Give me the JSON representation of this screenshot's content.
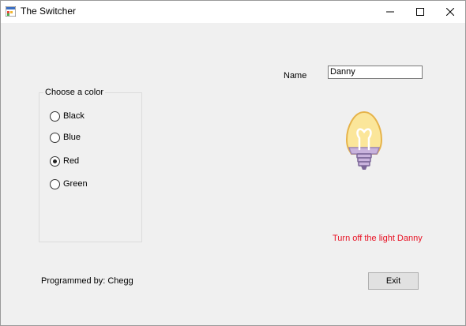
{
  "window": {
    "title": "The Switcher",
    "app_icon": "windows-form-icon",
    "controls": {
      "minimize_icon": "minimize-icon",
      "maximize_icon": "maximize-icon",
      "close_icon": "close-icon"
    }
  },
  "form": {
    "name_label": "Name",
    "name_value": "Danny",
    "color_group": {
      "title": "Choose a color",
      "options": [
        {
          "label": "Black",
          "checked": false
        },
        {
          "label": "Blue",
          "checked": false
        },
        {
          "label": "Red",
          "checked": true
        },
        {
          "label": "Green",
          "checked": false
        }
      ],
      "selected": "Red"
    },
    "bulb_icon": "light-bulb-icon",
    "status_message": "Turn off the light Danny",
    "status_color": "#e81123",
    "credit": "Programmed by: Chegg",
    "exit_label": "Exit"
  },
  "colors": {
    "window_bg": "#f0f0f0",
    "bulb_glass": "#fbe69a",
    "bulb_outline": "#e6b34a",
    "bulb_base": "#c9b3dd"
  }
}
